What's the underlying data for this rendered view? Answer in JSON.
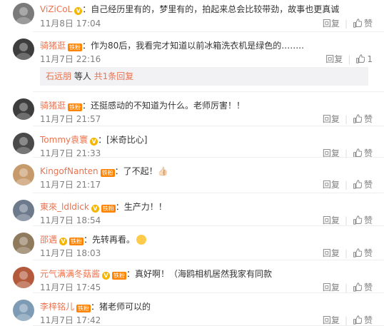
{
  "comments": [
    {
      "name": "ViZiCoL",
      "v": true,
      "fan": false,
      "text": "：自己经历里有的，梦里有的，拍起来总会比较带劲，故事也更真诚",
      "time": "11月8日 17:04",
      "reply": "回复",
      "like": "赞",
      "likes": "",
      "avatar_color": "#7a7a7a",
      "icon": "avatar-icon"
    },
    {
      "name": "骑猪逛",
      "v": false,
      "fan": true,
      "fan_label": "铁粉",
      "text": "：作为80后，我看完才知道以前冰箱洗衣机是绿色的……..",
      "time": "11月7日 22:16",
      "reply": "回复",
      "like": "",
      "likes": "1",
      "avatar_color": "#3d3d3d"
    },
    {
      "name": "骑猪逛",
      "v": false,
      "fan": true,
      "fan_label": "铁粉",
      "text": "：还挺感动的不知道为什么。老师厉害！！",
      "time": "11月7日 21:57",
      "reply": "回复",
      "like": "赞",
      "likes": "",
      "avatar_color": "#3d3d3d"
    },
    {
      "name": "Tommy袁寰",
      "v": true,
      "fan": false,
      "text": "：[米奇比心]",
      "time": "11月7日 21:33",
      "reply": "回复",
      "like": "赞",
      "likes": "",
      "avatar_color": "#4a4a4a"
    },
    {
      "name": "KingofNanten",
      "v": false,
      "fan": true,
      "fan_label": "铁粉",
      "text": "：了不起！👍🏻",
      "time": "11月7日 21:17",
      "reply": "回复",
      "like": "赞",
      "likes": "",
      "avatar_color": "#c79a6b"
    },
    {
      "name": "東來_ldldick",
      "v": true,
      "fan": true,
      "fan_label": "铁粉",
      "text": "：生产力！！",
      "time": "11月7日 18:54",
      "reply": "回复",
      "like": "赞",
      "likes": "",
      "avatar_color": "#6c7a8c"
    },
    {
      "name": "邵邁",
      "v": true,
      "fan": true,
      "fan_label": "铁粉",
      "text": "：先转再看。",
      "emoji": true,
      "time": "11月7日 18:03",
      "reply": "回复",
      "like": "赞",
      "likes": "",
      "avatar_color": "#8f7a5d"
    },
    {
      "name": "元气满满冬菇酱",
      "v": true,
      "fan": true,
      "fan_label": "铁粉",
      "text": "：真好啊！（海鸥相机居然我家有同款",
      "time": "11月7日 17:45",
      "reply": "回复",
      "like": "赞",
      "likes": "",
      "avatar_color": "#b35a3c"
    },
    {
      "name": "李梓铭儿",
      "v": false,
      "fan": true,
      "fan_label": "铁粉",
      "text": "：猪老师可以的",
      "time": "11月7日 17:42",
      "reply": "回复",
      "like": "赞",
      "likes": "",
      "avatar_color": "#7d9bb5"
    }
  ],
  "subreply": {
    "name": "石远朋",
    "middle": " 等人 ",
    "count": "共1条回复"
  }
}
